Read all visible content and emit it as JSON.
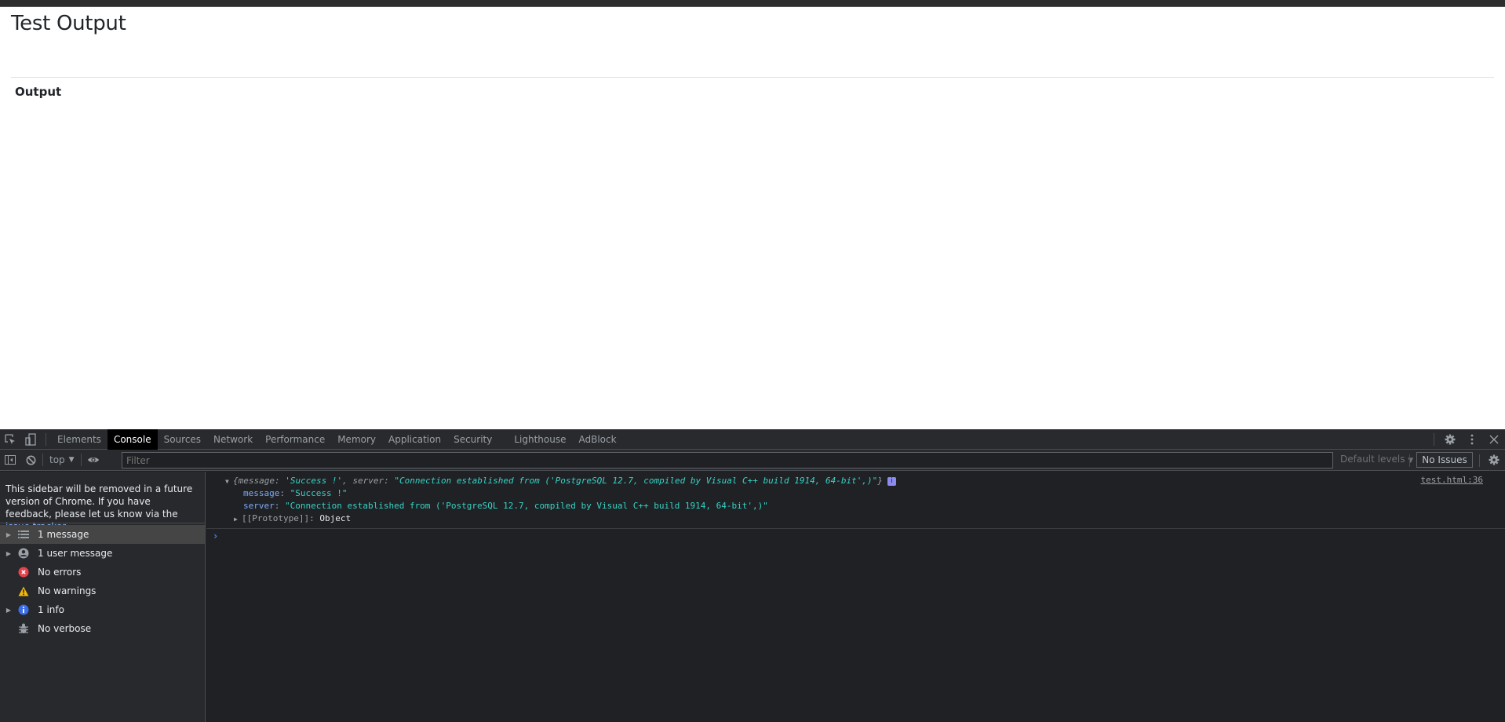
{
  "page": {
    "title": "Test Output",
    "section_heading": "Output"
  },
  "devtools": {
    "tabs": [
      {
        "label": "Elements",
        "active": false
      },
      {
        "label": "Console",
        "active": true
      },
      {
        "label": "Sources",
        "active": false
      },
      {
        "label": "Network",
        "active": false
      },
      {
        "label": "Performance",
        "active": false
      },
      {
        "label": "Memory",
        "active": false
      },
      {
        "label": "Application",
        "active": false
      },
      {
        "label": "Security",
        "active": false
      },
      {
        "label": "Lighthouse",
        "active": false
      },
      {
        "label": "AdBlock",
        "active": false
      }
    ],
    "icons": {
      "inspect": "inspect-element-icon",
      "device": "device-toggle-icon",
      "settings": "gear-icon",
      "more": "kebab-menu-icon",
      "close": "close-icon"
    },
    "toolbar": {
      "context": "top",
      "filter_placeholder": "Filter",
      "filter_value": "",
      "levels": "Default levels",
      "issues": "No Issues"
    },
    "sidebar": {
      "notice_text": "This sidebar will be removed in a future version of Chrome. If you have feedback, please let us know via the ",
      "notice_link": "issue tracker",
      "notice_end": ".",
      "items": [
        {
          "label": "1 message",
          "icon": "list-icon",
          "expandable": true,
          "selected": true
        },
        {
          "label": "1 user message",
          "icon": "user-icon",
          "expandable": true,
          "selected": false
        },
        {
          "label": "No errors",
          "icon": "error-icon",
          "expandable": false,
          "selected": false
        },
        {
          "label": "No warnings",
          "icon": "warning-icon",
          "expandable": false,
          "selected": false
        },
        {
          "label": "1 info",
          "icon": "info-icon",
          "expandable": true,
          "selected": false
        },
        {
          "label": "No verbose",
          "icon": "bug-icon",
          "expandable": false,
          "selected": false
        }
      ]
    },
    "console": {
      "message": {
        "summary_open": "{",
        "summary_key1": "message",
        "summary_val1": "'Success !'",
        "summary_sep": ", ",
        "summary_key2": "server",
        "summary_val2": "\"Connection established from ('PostgreSQL 12.7, compiled by Visual C++ build 1914, 64-bit',)\"",
        "summary_close": "}",
        "prop1_key": "message",
        "prop1_val": "\"Success !\"",
        "prop2_key": "server",
        "prop2_val": "\"Connection established from ('PostgreSQL 12.7, compiled by Visual C++ build 1914, 64-bit',)\"",
        "proto_key": "[[Prototype]]",
        "proto_val": "Object",
        "source": "test.html:36",
        "info_badge": "i"
      },
      "prompt": "›"
    }
  }
}
